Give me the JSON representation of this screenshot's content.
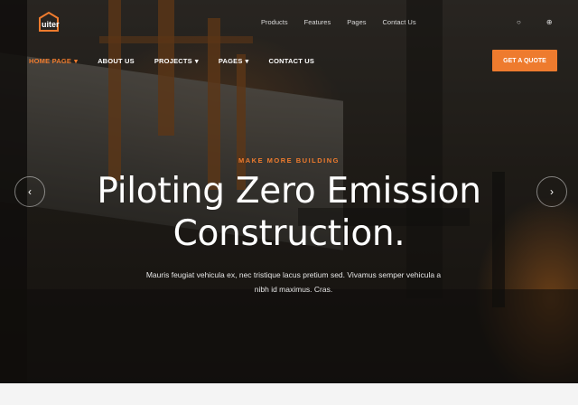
{
  "brand": {
    "logo_text": "uiter",
    "accent": "#ee7b2e"
  },
  "top_nav": [
    "Products",
    "Features",
    "Pages",
    "Contact Us"
  ],
  "top_icons": [
    "user-icon",
    "globe-icon"
  ],
  "main_nav": [
    {
      "label": "HOME PAGE",
      "active": true,
      "has_dropdown": true
    },
    {
      "label": "ABOUT US",
      "active": false,
      "has_dropdown": false
    },
    {
      "label": "PROJECTS",
      "active": false,
      "has_dropdown": true
    },
    {
      "label": "PAGES",
      "active": false,
      "has_dropdown": true
    },
    {
      "label": "CONTACT US",
      "active": false,
      "has_dropdown": false
    }
  ],
  "cta_label": "GET A QUOTE",
  "hero": {
    "eyebrow": "MAKE MORE BUILDING",
    "title_line1": "Piloting Zero Emission",
    "title_line2": "Construction.",
    "subtitle": "Mauris feugiat vehicula ex, nec tristique lacus pretium sed. Vivamus semper vehicula a nibh id maximus. Cras."
  }
}
